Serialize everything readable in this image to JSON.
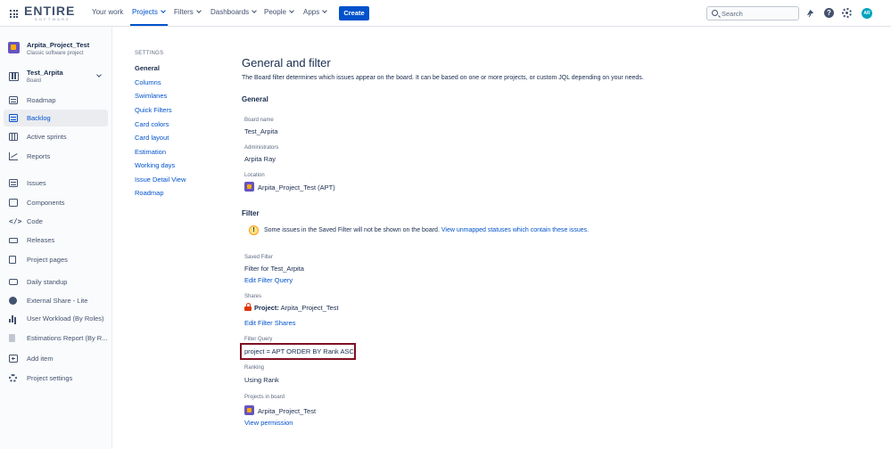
{
  "topnav": {
    "logo_main": "ENTIRE",
    "logo_sub": "SOFTWARE",
    "items": [
      {
        "label": "Your work",
        "chevron": false
      },
      {
        "label": "Projects",
        "chevron": true,
        "active": true
      },
      {
        "label": "Filters",
        "chevron": true
      },
      {
        "label": "Dashboards",
        "chevron": true
      },
      {
        "label": "People",
        "chevron": true
      },
      {
        "label": "Apps",
        "chevron": true
      }
    ],
    "create_label": "Create",
    "search_placeholder": "Search",
    "help_glyph": "?",
    "avatar_initials": "AR",
    "accent_color": "#0052cc"
  },
  "sidebar": {
    "project_name": "Arpita_Project_Test",
    "project_type": "Classic software project",
    "board_name": "Test_Arpita",
    "board_sub": "Board",
    "items": [
      {
        "label": "Roadmap",
        "icon": "roadmap-icon"
      },
      {
        "label": "Backlog",
        "icon": "backlog-icon",
        "selected": true
      },
      {
        "label": "Active sprints",
        "icon": "active-sprints-icon"
      },
      {
        "label": "Reports",
        "icon": "reports-icon"
      },
      {
        "label": "Issues",
        "icon": "issues-icon"
      },
      {
        "label": "Components",
        "icon": "components-icon"
      },
      {
        "label": "Code",
        "icon": "code-icon",
        "glyph": "</>"
      },
      {
        "label": "Releases",
        "icon": "releases-icon"
      },
      {
        "label": "Project pages",
        "icon": "project-pages-icon"
      },
      {
        "label": "Daily standup",
        "icon": "daily-standup-icon"
      },
      {
        "label": "External Share - Lite",
        "icon": "external-share-icon"
      },
      {
        "label": "User Workload (By Roles)",
        "icon": "user-workload-icon"
      },
      {
        "label": "Estimations Report (By R...",
        "icon": "estimations-report-icon"
      },
      {
        "label": "Add item",
        "icon": "add-item-icon"
      },
      {
        "label": "Project settings",
        "icon": "project-settings-icon"
      }
    ]
  },
  "settings_nav": {
    "heading": "SETTINGS",
    "items": [
      "General",
      "Columns",
      "Swimlanes",
      "Quick Filters",
      "Card colors",
      "Card layout",
      "Estimation",
      "Working days",
      "Issue Detail View",
      "Roadmap"
    ],
    "current": "General"
  },
  "main": {
    "title": "General and filter",
    "description": "The Board filter determines which issues appear on the board. It can be based on one or more projects, or custom JQL depending on your needs.",
    "general_heading": "General",
    "board_name_label": "Board name",
    "board_name_value": "Test_Arpita",
    "administrators_label": "Administrators",
    "administrators_value": "Arpita Ray",
    "location_label": "Location",
    "location_value": "Arpita_Project_Test (APT)",
    "filter_heading": "Filter",
    "warning_glyph": "!",
    "warning_text": "Some issues in the Saved Filter will not be shown on the board.",
    "warning_link": "View unmapped statuses which contain these issues.",
    "saved_filter_label": "Saved Filter",
    "saved_filter_value": "Filter for Test_Arpita",
    "edit_filter_query_link": "Edit Filter Query",
    "shares_label": "Shares",
    "shares_prefix": "Project:",
    "shares_value": "Arpita_Project_Test",
    "edit_filter_shares_link": "Edit Filter Shares",
    "filter_query_label": "Filter Query",
    "filter_query_value": "project = APT ORDER BY Rank ASC",
    "ranking_label": "Ranking",
    "ranking_value": "Using Rank",
    "projects_in_board_label": "Projects in board",
    "projects_in_board_value": "Arpita_Project_Test",
    "view_permission_link": "View permission",
    "highlight_color": "#7f1022"
  }
}
